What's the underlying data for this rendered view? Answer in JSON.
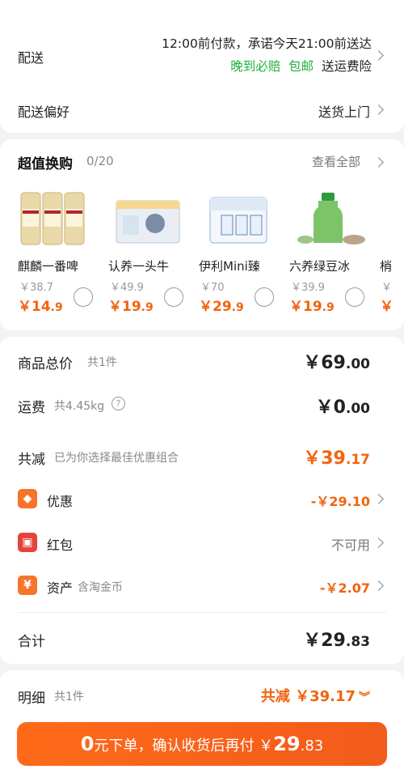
{
  "delivery": {
    "label": "配送",
    "line1": "12:00前付款，承诺今天21:00前送达",
    "tag_late": "晚到必赔",
    "tag_free": "包邮",
    "tag_insurance": "送运费险",
    "pref_label": "配送偏好",
    "pref_value": "送货上门"
  },
  "addon": {
    "title": "超值换购",
    "count": "0/20",
    "view_all": "查看全部",
    "products": [
      {
        "name": "麒麟一番啤",
        "orig": "￥38.7",
        "price_int": "￥14",
        "price_dec": ".9",
        "icon": "beer-cans-icon"
      },
      {
        "name": "认养一头牛",
        "orig": "￥49.9",
        "price_int": "￥19",
        "price_dec": ".9",
        "icon": "milk-box-icon"
      },
      {
        "name": "伊利Mini臻",
        "orig": "￥70",
        "price_int": "￥29",
        "price_dec": ".9",
        "icon": "yili-box-icon"
      },
      {
        "name": "六养绿豆冰",
        "orig": "￥39.9",
        "price_int": "￥19",
        "price_dec": ".9",
        "icon": "green-bottle-icon"
      },
      {
        "name": "梢",
        "orig": "￥",
        "price_int": "￥",
        "price_dec": "",
        "icon": "partial-product-icon"
      }
    ]
  },
  "summary": {
    "goods_label": "商品总价",
    "goods_count": "共1件",
    "goods_int": "￥69",
    "goods_dec": ".00",
    "ship_label": "运费",
    "ship_weight": "共4.45kg",
    "ship_int": "￥0",
    "ship_dec": ".00",
    "reduce_label": "共减",
    "reduce_sub": "已为你选择最佳优惠组合",
    "reduce_int": "￥39",
    "reduce_dec": ".17",
    "discount_label": "优惠",
    "discount_val": "-￥29.10",
    "redpacket_label": "红包",
    "redpacket_val": "不可用",
    "asset_label": "资产",
    "asset_sub": "含淘金币",
    "asset_val": "-￥2.07",
    "total_label": "合计",
    "total_int": "￥29",
    "total_dec": ".83"
  },
  "bottom": {
    "detail_label": "明细",
    "detail_count": "共1件",
    "detail_save": "共减 ￥39.17",
    "btn_zero": "0",
    "btn_text": "元下单，确认收货后再付 ￥",
    "btn_int": "29",
    "btn_dec": ".83"
  },
  "colors": {
    "accent": "#f2640f",
    "green": "#1fae3a",
    "button": "#ff6a1a"
  }
}
